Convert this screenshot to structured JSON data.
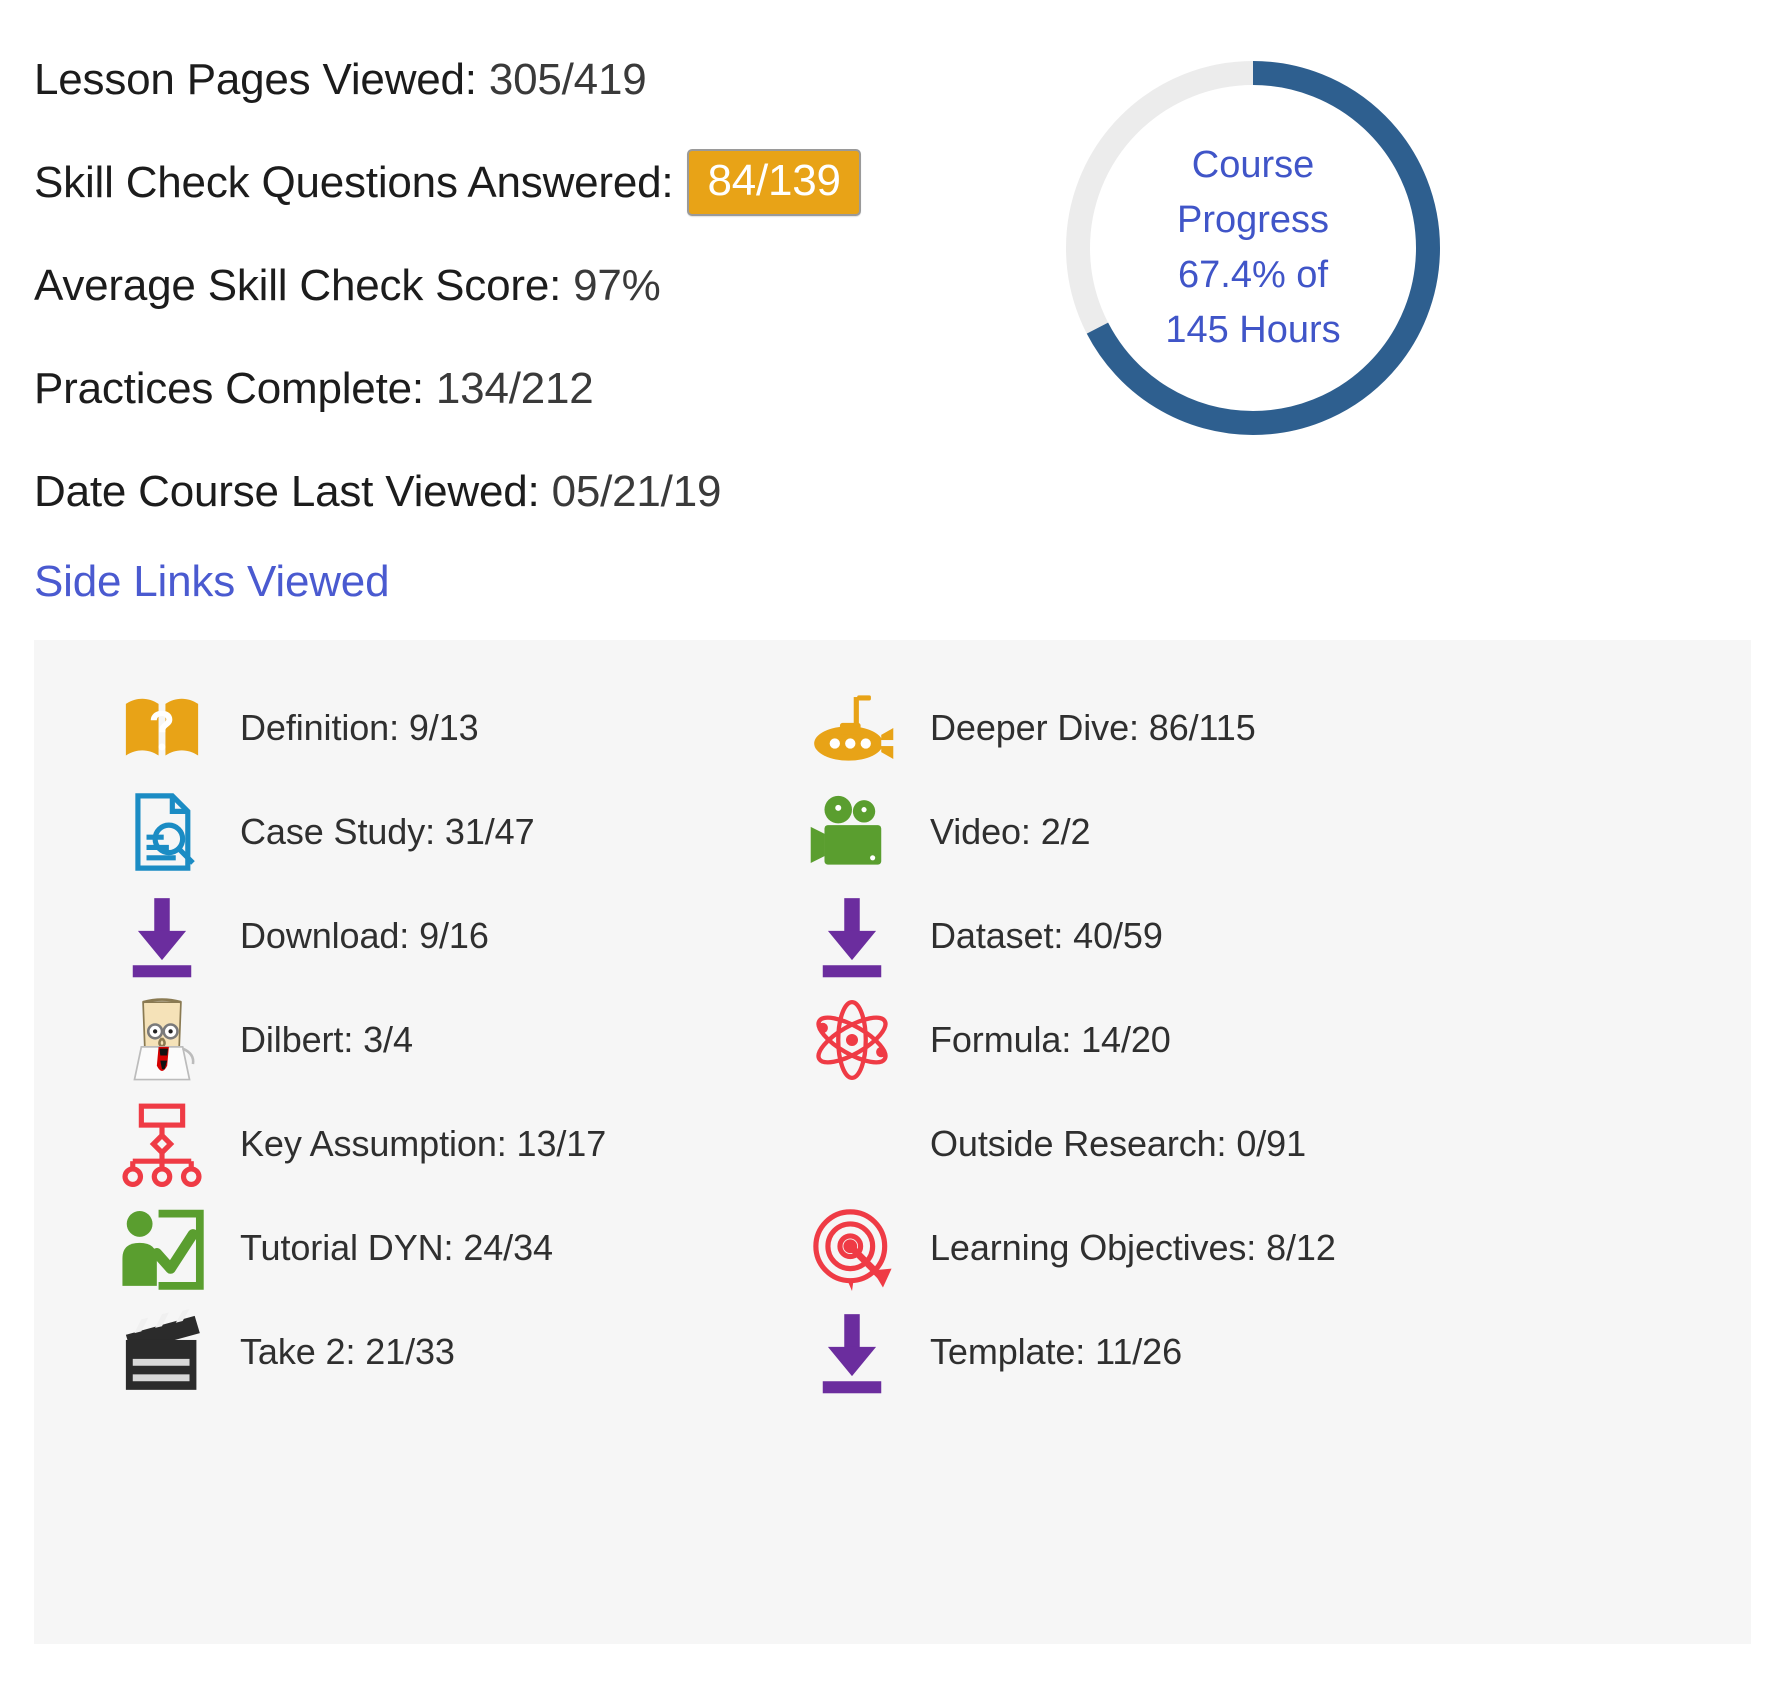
{
  "stats": [
    {
      "label": "Lesson Pages Viewed:",
      "value": "305/419",
      "badge": false
    },
    {
      "label": "Skill Check Questions Answered:",
      "value": "84/139",
      "badge": true
    },
    {
      "label": "Average Skill Check Score:",
      "value": "97%",
      "badge": false
    },
    {
      "label": "Practices Complete:",
      "value": "134/212",
      "badge": false
    },
    {
      "label": "Date Course Last Viewed:",
      "value": "05/21/19",
      "badge": false
    }
  ],
  "progress": {
    "line1": "Course",
    "line2": "Progress",
    "line3": "67.4% of",
    "line4": "145 Hours",
    "percent": 67.4,
    "hours": 145,
    "arc_color": "#2e5f8f",
    "track_color": "#ececec",
    "text_color": "#4055c8"
  },
  "side_links": {
    "heading": "Side Links Viewed",
    "panel_bg": "#f6f6f6",
    "left": [
      {
        "icon": "definition-book-icon",
        "text": "Definition: 9/13",
        "viewed": 9,
        "total": 13
      },
      {
        "icon": "case-study-icon",
        "text": "Case Study: 31/47",
        "viewed": 31,
        "total": 47
      },
      {
        "icon": "download-arrow-icon",
        "text": "Download: 9/16",
        "viewed": 9,
        "total": 16
      },
      {
        "icon": "dilbert-icon",
        "text": "Dilbert: 3/4",
        "viewed": 3,
        "total": 4
      },
      {
        "icon": "key-assumption-icon",
        "text": "Key Assumption: 13/17",
        "viewed": 13,
        "total": 17
      },
      {
        "icon": "tutorial-dyn-icon",
        "text": "Tutorial DYN: 24/34",
        "viewed": 24,
        "total": 34
      },
      {
        "icon": "clapperboard-icon",
        "text": "Take 2: 21/33",
        "viewed": 21,
        "total": 33
      }
    ],
    "right": [
      {
        "icon": "submarine-icon",
        "text": "Deeper Dive: 86/115",
        "viewed": 86,
        "total": 115
      },
      {
        "icon": "video-camera-icon",
        "text": "Video: 2/2",
        "viewed": 2,
        "total": 2
      },
      {
        "icon": "download-arrow-icon",
        "text": "Dataset: 40/59",
        "viewed": 40,
        "total": 59
      },
      {
        "icon": "atom-icon",
        "text": "Formula: 14/20",
        "viewed": 14,
        "total": 20
      },
      {
        "icon": "none",
        "text": "Outside Research: 0/91",
        "viewed": 0,
        "total": 91
      },
      {
        "icon": "target-dart-icon",
        "text": "Learning Objectives: 8/12",
        "viewed": 8,
        "total": 12
      },
      {
        "icon": "download-arrow-icon",
        "text": "Template: 11/26",
        "viewed": 11,
        "total": 26
      }
    ]
  }
}
